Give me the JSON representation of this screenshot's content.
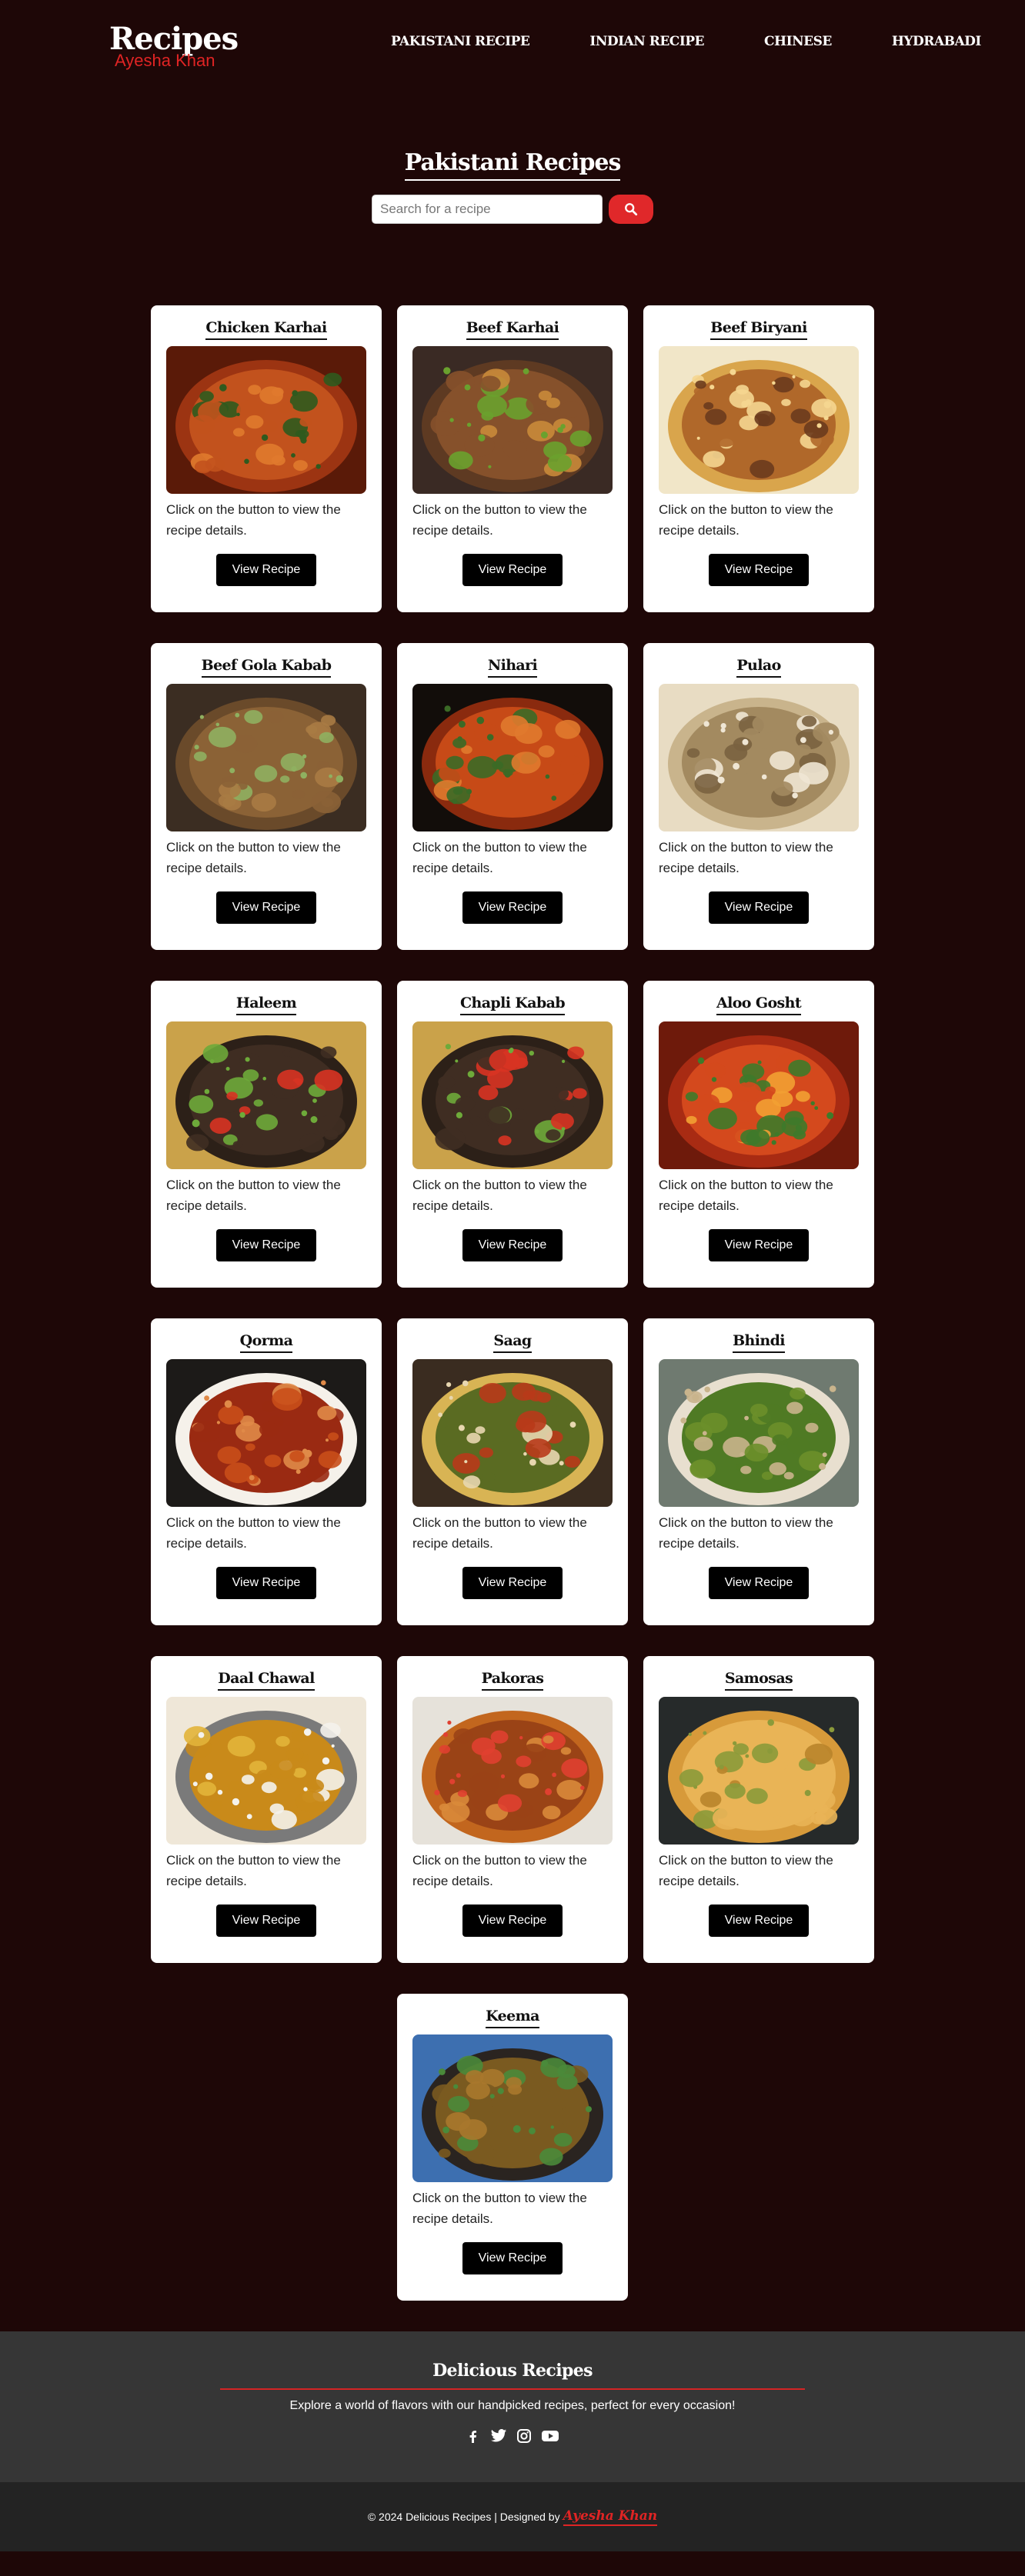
{
  "brand": {
    "title": "Recipes",
    "subtitle": "Ayesha Khan"
  },
  "nav": [
    {
      "label": "PAKISTANI RECIPE"
    },
    {
      "label": "INDIAN RECIPE"
    },
    {
      "label": "CHINESE"
    },
    {
      "label": "HYDRABADI"
    }
  ],
  "hero": {
    "title": "Pakistani Recipes",
    "search_placeholder": "Search for a recipe",
    "search_icon": "search-icon"
  },
  "card_text": "Click on the button to view the recipe details.",
  "card_button": "View Recipe",
  "recipes": [
    {
      "name": "Chicken Karhai"
    },
    {
      "name": "Beef Karhai"
    },
    {
      "name": "Beef Biryani"
    },
    {
      "name": "Beef Gola Kabab"
    },
    {
      "name": "Nihari"
    },
    {
      "name": "Pulao"
    },
    {
      "name": "Haleem"
    },
    {
      "name": "Chapli Kabab"
    },
    {
      "name": "Aloo Gosht"
    },
    {
      "name": "Qorma"
    },
    {
      "name": "Saag"
    },
    {
      "name": "Bhindi"
    },
    {
      "name": "Daal Chawal"
    },
    {
      "name": "Pakoras"
    },
    {
      "name": "Samosas"
    },
    {
      "name": "Keema"
    }
  ],
  "footer": {
    "title": "Delicious Recipes",
    "text": "Explore a world of flavors with our handpicked recipes, perfect for every occasion!",
    "social": [
      "facebook-icon",
      "twitter-icon",
      "instagram-icon",
      "youtube-icon"
    ],
    "copyright": "© 2024 Delicious Recipes | Designed by",
    "author": "Ayesha Khan"
  },
  "colors": {
    "background": "#1e0707",
    "accent": "#e0282a",
    "card": "#ffffff",
    "button": "#000000",
    "footer": "#363636",
    "bottombar": "#232323"
  }
}
